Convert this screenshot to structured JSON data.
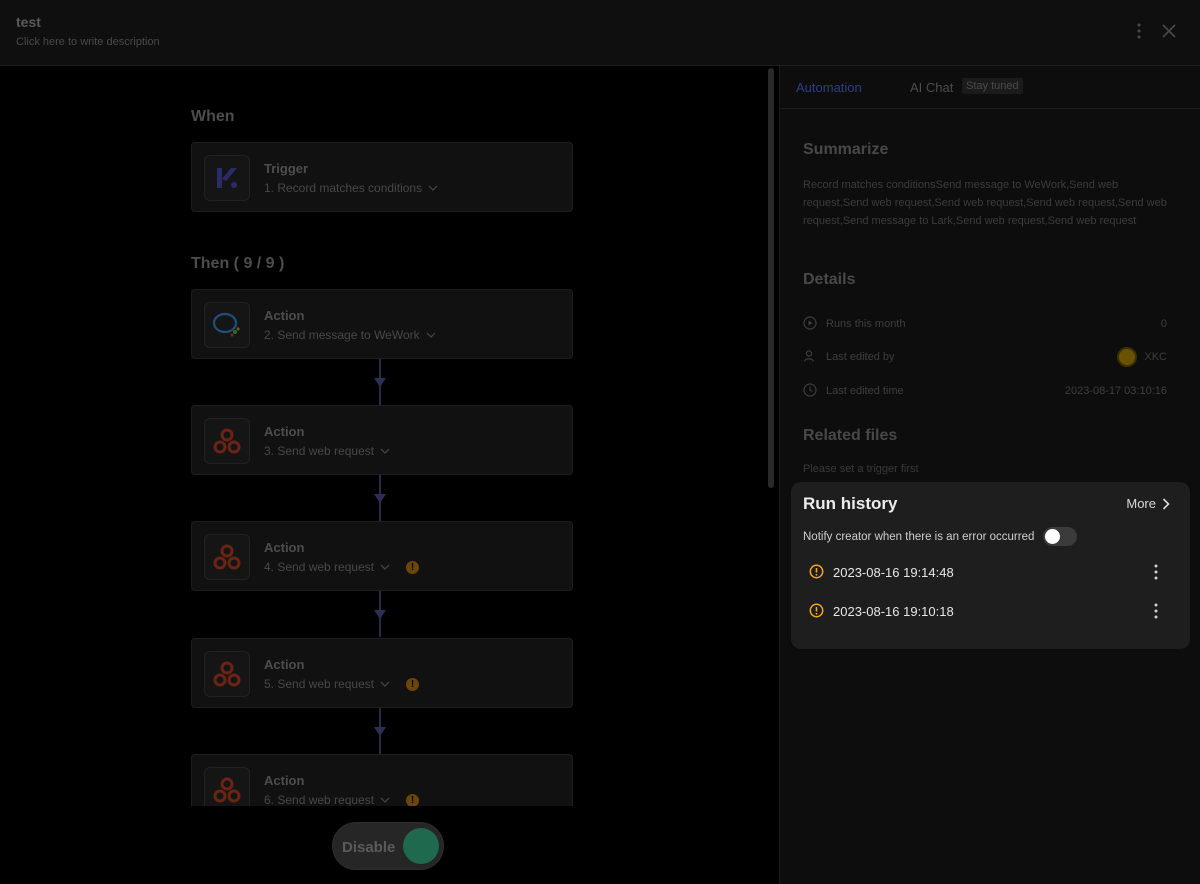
{
  "header": {
    "title": "test",
    "description": "Click here to write description"
  },
  "canvas": {
    "when_label": "When",
    "then_label": "Then ( 9 / 9 )",
    "nodes": [
      {
        "type": "Trigger",
        "label": "1. Record matches conditions",
        "icon": "trigger-logo-icon",
        "warning": false
      },
      {
        "type": "Action",
        "label": "2. Send message to WeWork",
        "icon": "wework-icon",
        "warning": false
      },
      {
        "type": "Action",
        "label": "3. Send web request",
        "icon": "webhook-icon",
        "warning": false
      },
      {
        "type": "Action",
        "label": "4. Send web request",
        "icon": "webhook-icon",
        "warning": true
      },
      {
        "type": "Action",
        "label": "5. Send web request",
        "icon": "webhook-icon",
        "warning": true
      },
      {
        "type": "Action",
        "label": "6. Send web request",
        "icon": "webhook-icon",
        "warning": true
      }
    ],
    "toggle_label": "Disable"
  },
  "panel": {
    "tabs": {
      "automation": "Automation",
      "ai_chat": "AI Chat",
      "ai_chat_badge": "Stay tuned"
    },
    "summarize_title": "Summarize",
    "summary_text": "Record matches conditionsSend message to WeWork,Send web request,Send web request,Send web request,Send web request,Send web request,Send message to Lark,Send web request,Send web request",
    "details_title": "Details",
    "details": {
      "runs_label": "Runs this month",
      "runs_value": "0",
      "edited_by_label": "Last edited by",
      "edited_by_value": "XKC",
      "edited_time_label": "Last edited time",
      "edited_time_value": "2023-08-17 03:10:16"
    },
    "related_title": "Related files",
    "related_note": "Please set a trigger first"
  },
  "run_history": {
    "title": "Run history",
    "more_label": "More",
    "notify_label": "Notify creator when there is an error occurred",
    "notify_enabled": false,
    "items": [
      {
        "time": "2023-08-16 19:14:48",
        "status": "warning"
      },
      {
        "time": "2023-08-16 19:10:18",
        "status": "warning"
      }
    ]
  },
  "colors": {
    "accent": "#2d3f85",
    "warning": "#f5a623",
    "toggle_on": "#1f6a4e"
  }
}
